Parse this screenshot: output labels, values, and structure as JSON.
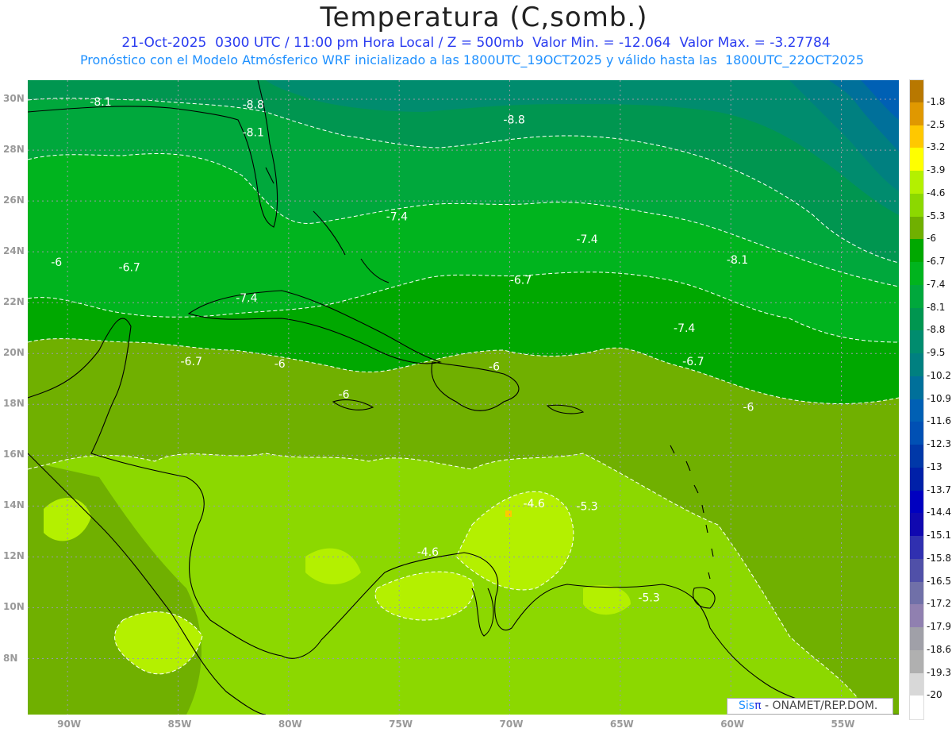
{
  "title": "Temperatura (C,somb.)",
  "subtitle1": "21-Oct-2025  0300 UTC / 11:00 pm Hora Local / Z = 500mb  Valor Min. = -12.064  Valor Max. = -3.27784",
  "subtitle2": "Pronóstico con el Modelo Atmósferico WRF inicializado a las 1800UTC_19OCT2025 y válido hasta las  1800UTC_22OCT2025",
  "logo": {
    "sis": "Sis",
    "pi": "π",
    "text": " - ONAMET/REP.DOM."
  },
  "map": {
    "lon_range": [
      -91.8,
      -52.4
    ],
    "lat_range": [
      5.8,
      30.75
    ],
    "lon_ticks": [
      "90W",
      "85W",
      "80W",
      "75W",
      "70W",
      "65W",
      "60W",
      "55W"
    ],
    "lat_ticks": [
      "30N",
      "28N",
      "26N",
      "24N",
      "22N",
      "20N",
      "18N",
      "16N",
      "14N",
      "12N",
      "10N",
      "8N"
    ],
    "grid": true,
    "contour_labels": [
      {
        "text": "-8.1",
        "lon": -88.5,
        "lat": 29.9
      },
      {
        "text": "-8.8",
        "lon": -81.6,
        "lat": 29.8
      },
      {
        "text": "-8.1",
        "lon": -81.6,
        "lat": 28.7
      },
      {
        "text": "-8.8",
        "lon": -69.8,
        "lat": 29.2
      },
      {
        "text": "-7.4",
        "lon": -75.1,
        "lat": 25.4
      },
      {
        "text": "-7.4",
        "lon": -66.5,
        "lat": 24.5
      },
      {
        "text": "-8.1",
        "lon": -59.7,
        "lat": 23.7
      },
      {
        "text": "-6",
        "lon": -90.5,
        "lat": 23.6
      },
      {
        "text": "-6.7",
        "lon": -87.2,
        "lat": 23.4
      },
      {
        "text": "-6.7",
        "lon": -69.5,
        "lat": 22.9
      },
      {
        "text": "-7.4",
        "lon": -81.9,
        "lat": 22.2
      },
      {
        "text": "-7.4",
        "lon": -62.1,
        "lat": 21.0
      },
      {
        "text": "-6.7",
        "lon": -84.4,
        "lat": 19.7
      },
      {
        "text": "-6",
        "lon": -80.4,
        "lat": 19.6
      },
      {
        "text": "-6",
        "lon": -70.7,
        "lat": 19.5
      },
      {
        "text": "-6.7",
        "lon": -61.7,
        "lat": 19.7
      },
      {
        "text": "-6",
        "lon": -77.5,
        "lat": 18.4
      },
      {
        "text": "-6",
        "lon": -59.2,
        "lat": 17.9
      },
      {
        "text": "-4.6",
        "lon": -68.9,
        "lat": 14.1
      },
      {
        "text": "-5.3",
        "lon": -66.5,
        "lat": 14.0
      },
      {
        "text": "-4.6",
        "lon": -73.7,
        "lat": 12.2
      },
      {
        "text": "-5.3",
        "lon": -63.7,
        "lat": 10.4
      }
    ]
  },
  "colorbar": {
    "labels": [
      "-1.8",
      "-2.5",
      "-3.2",
      "-3.9",
      "-4.6",
      "-5.3",
      "-6",
      "-6.7",
      "-7.4",
      "-8.1",
      "-8.8",
      "-9.5",
      "-10.2",
      "-10.9",
      "-11.6",
      "-12.3",
      "-13",
      "-13.7",
      "-14.4",
      "-15.1",
      "-15.8",
      "-16.5",
      "-17.2",
      "-17.9",
      "-18.6",
      "-19.3",
      "-20"
    ],
    "colors": [
      "#b87800",
      "#e09800",
      "#ffc800",
      "#ffff00",
      "#b4f000",
      "#8cd800",
      "#70b000",
      "#00a800",
      "#00b41e",
      "#00a83c",
      "#009650",
      "#008c6e",
      "#008080",
      "#00709a",
      "#0060b4",
      "#0050b4",
      "#0038a8",
      "#0020a8",
      "#0000c0",
      "#1008b0",
      "#3030b0",
      "#5050a8",
      "#7070a8",
      "#9080b0",
      "#a0a0a8",
      "#b0b0b0",
      "#d8d8d8",
      "#ffffff"
    ]
  }
}
